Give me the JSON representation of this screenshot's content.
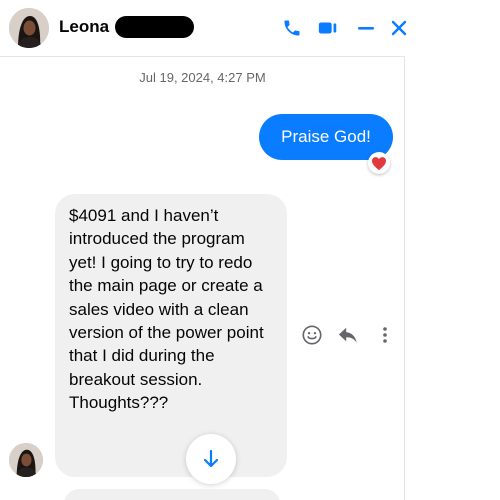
{
  "header": {
    "contact_name": "Leona",
    "icons": [
      "phone-icon",
      "video-icon",
      "minimize-icon",
      "close-icon"
    ]
  },
  "conversation": {
    "timestamp": "Jul 19, 2024, 4:27 PM",
    "messages": [
      {
        "direction": "outgoing",
        "text": "Praise God!",
        "reaction": "heart"
      },
      {
        "direction": "incoming",
        "text": "$4091 and I haven’t introduced the program yet! I  going to try to redo the main page or create a sales video with a clean version of the power point that I did during the breakout session. Thoughts???"
      }
    ],
    "message_actions": [
      "react-icon",
      "reply-icon",
      "more-icon"
    ]
  },
  "colors": {
    "accent": "#0a7cff",
    "outgoing_bubble": "#0a7cff",
    "incoming_bubble": "#f0f0f0",
    "timestamp_text": "#65676b",
    "reaction_heart": "#e0393e"
  }
}
